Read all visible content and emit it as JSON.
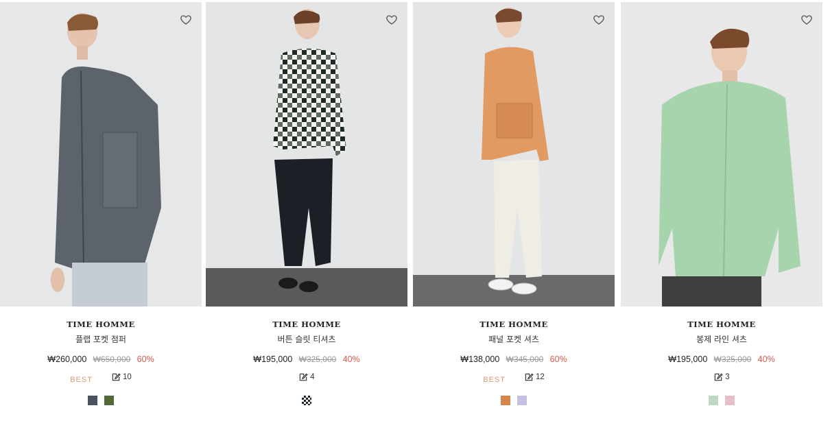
{
  "products": [
    {
      "brand": "TIME HOMME",
      "name": "플랩 포켓 점퍼",
      "price": "₩260,000",
      "original_price": "₩650,000",
      "discount": "60%",
      "badge": "BEST",
      "review_count": "10",
      "swatches": [
        "#4a5260",
        "#4f6a36"
      ],
      "background": "#e6e7e9",
      "floor": "#e6e7e9"
    },
    {
      "brand": "TIME HOMME",
      "name": "버튼 슬릿 티셔츠",
      "price": "₩195,000",
      "original_price": "₩325,000",
      "discount": "40%",
      "badge": "",
      "review_count": "4",
      "swatches": [
        "checker-black-white"
      ],
      "background": "#e4e5e7",
      "floor": "#5b5a5a"
    },
    {
      "brand": "TIME HOMME",
      "name": "패널 포켓 셔츠",
      "price": "₩138,000",
      "original_price": "₩345,000",
      "discount": "60%",
      "badge": "BEST",
      "review_count": "12",
      "swatches": [
        "#d8844f",
        "#c5c0df"
      ],
      "background": "#e4e5e7",
      "floor": "#6a6a6a"
    },
    {
      "brand": "TIME HOMME",
      "name": "봉제 라인 셔츠",
      "price": "₩195,000",
      "original_price": "₩325,000",
      "discount": "40%",
      "badge": "",
      "review_count": "3",
      "swatches": [
        "#b9dbbf",
        "#e5c1c7"
      ],
      "background": "#e8e8e8",
      "floor": "#e8e8e8"
    }
  ],
  "icons": {
    "wishlist": "heart-outline-icon",
    "review": "edit-pencil-icon"
  }
}
